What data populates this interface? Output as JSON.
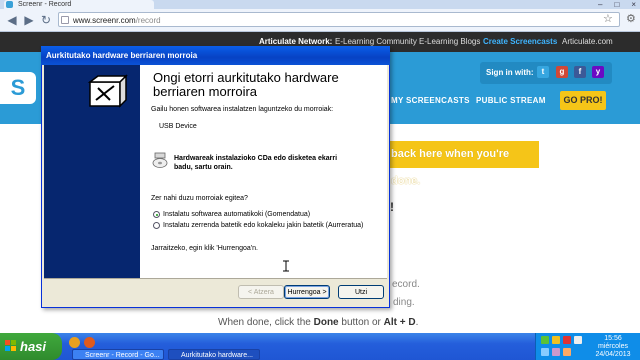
{
  "browser": {
    "tab_title": "Screenr - Record",
    "url_host": "www.screenr.com",
    "url_path": "/record",
    "window_controls": [
      "–",
      "□",
      "×"
    ]
  },
  "site": {
    "articulate_network_label": "Articulate Network:",
    "network_links": [
      "E-Learning Community",
      "E-Learning Blogs",
      "Create Screencasts",
      "Articulate.com"
    ],
    "logo_letter": "S",
    "signin_label": "Sign in with:",
    "social_icons": [
      "twitter-icon",
      "google-icon",
      "facebook-icon",
      "yahoo-icon"
    ],
    "nav": [
      "MY SCREENCASTS",
      "PUBLIC STREAM"
    ],
    "gopro": "GO PRO!",
    "banner_text": "back here when you're done.",
    "exclaim": "!",
    "record_text": "ecord.",
    "recording_text": "ding.",
    "instruction": {
      "pre": "When done, click the ",
      "done": "Done",
      "mid": " button or ",
      "shortcut": "Alt + D",
      "post": "."
    }
  },
  "dialog": {
    "title": "Aurkitutako hardware berriaren morroia",
    "heading": "Ongi etorri aurkitutako hardware berriaren morroira",
    "intro": "Gailu honen softwarea instalatzen laguntzeko du morroiak:",
    "device": "USB Device",
    "cd_text_1": "Hardwareak instalazioko CDa edo disketea ekarri",
    "cd_text_2": "badu, sartu orain.",
    "question": "Zer nahi duzu morroiak egitea?",
    "options": [
      {
        "label": "Instalatu softwarea automatikoki (Gomendatua)",
        "selected": true
      },
      {
        "label": "Instalatu zerrenda batetik edo kokaleku jakin batetik (Aurreratua)",
        "selected": false
      }
    ],
    "continue_text": "Jarraitzeko, egin klik 'Hurrengoa'n.",
    "buttons": {
      "back": "< Atzera",
      "next": "Hurrengoa >",
      "cancel": "Utzi"
    }
  },
  "taskbar": {
    "start_label": "hasi",
    "tasks": [
      "Screenr - Record - Go...",
      "Aurkitutako hardware..."
    ],
    "clock_time": "15:56",
    "clock_day": "miércoles",
    "clock_date": "24/04/2013"
  },
  "colors": {
    "xp_blue": "#245edb",
    "screenr_blue": "#2b9bd6",
    "gopro_yellow": "#f5c518",
    "start_green": "#3a9d37"
  }
}
